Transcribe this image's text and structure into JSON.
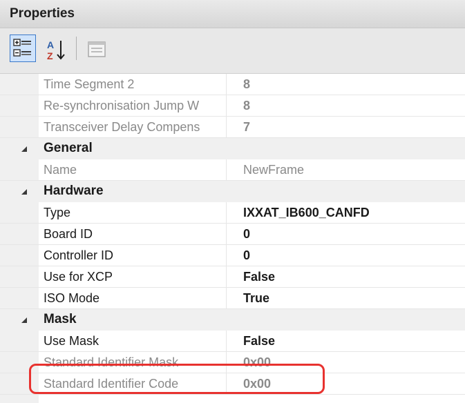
{
  "panel": {
    "title": "Properties"
  },
  "toolbar": {
    "categorized_icon": "categorized-view-icon",
    "alphabetical_icon": "sort-alphabetical-icon",
    "property_pages_icon": "property-pages-icon"
  },
  "rows": [
    {
      "kind": "prop",
      "label": "Time Segment 2",
      "value": "8",
      "dim": true,
      "bold": true
    },
    {
      "kind": "prop",
      "label": "Re-synchronisation Jump W",
      "value": "8",
      "dim": true,
      "bold": true
    },
    {
      "kind": "prop",
      "label": "Transceiver Delay Compens",
      "value": "7",
      "dim": true,
      "bold": true
    },
    {
      "kind": "category",
      "label": "General"
    },
    {
      "kind": "prop",
      "label": "Name",
      "value": "NewFrame",
      "dim": true,
      "bold": false
    },
    {
      "kind": "category",
      "label": "Hardware"
    },
    {
      "kind": "prop",
      "label": "Type",
      "value": "IXXAT_IB600_CANFD",
      "dim": false,
      "bold": true
    },
    {
      "kind": "prop",
      "label": "Board ID",
      "value": "0",
      "dim": false,
      "bold": true
    },
    {
      "kind": "prop",
      "label": "Controller ID",
      "value": "0",
      "dim": false,
      "bold": true
    },
    {
      "kind": "prop",
      "label": "Use for XCP",
      "value": "False",
      "dim": false,
      "bold": true
    },
    {
      "kind": "prop",
      "label": "ISO Mode",
      "value": "True",
      "dim": false,
      "bold": true
    },
    {
      "kind": "category",
      "label": "Mask"
    },
    {
      "kind": "prop",
      "label": "Use Mask",
      "value": "False",
      "dim": false,
      "bold": true
    },
    {
      "kind": "prop",
      "label": "Standard Identifier Mask",
      "value": "0x00",
      "dim": true,
      "bold": true
    },
    {
      "kind": "prop",
      "label": "Standard Identifier Code",
      "value": "0x00",
      "dim": true,
      "bold": true
    }
  ],
  "colors": {
    "highlight": "#e8322f",
    "selected_button": "#cfe3fb",
    "category_bg": "#f0f0f0",
    "dim_text": "#8a8a8a"
  }
}
